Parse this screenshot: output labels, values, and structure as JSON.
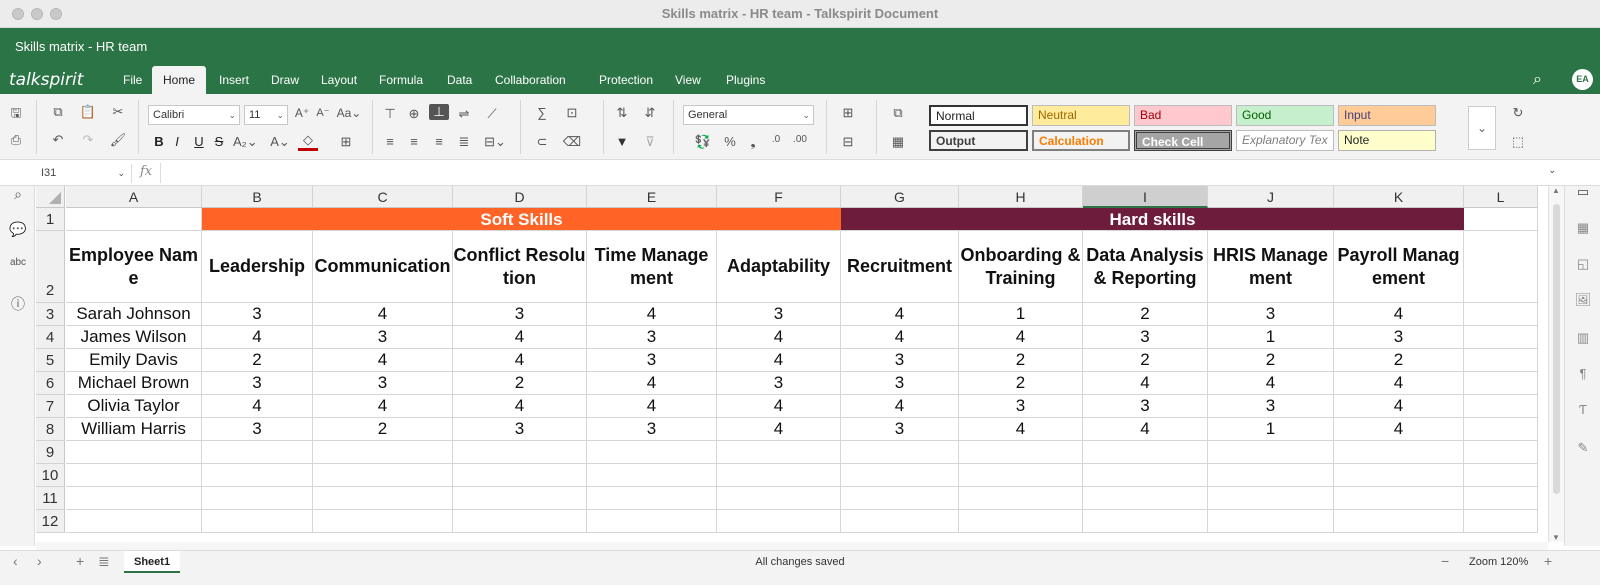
{
  "window": {
    "title": "Skills matrix - HR team - Talkspirit Document"
  },
  "doc": {
    "title": "Skills matrix - HR team"
  },
  "app": {
    "logo": "talkspirit",
    "avatar": "EA"
  },
  "menu": [
    "File",
    "Home",
    "Insert",
    "Draw",
    "Layout",
    "Formula",
    "Data",
    "Collaboration",
    "Protection",
    "View",
    "Plugins"
  ],
  "toolbar": {
    "font_name": "Calibri",
    "font_size": "11",
    "number_format": "General",
    "bold": "B",
    "italic": "I",
    "underline": "U",
    "strike": "S",
    "percent": "%",
    "styles": [
      "Normal",
      "Neutral",
      "Bad",
      "Good",
      "Input",
      "Output",
      "Calculation",
      "Check Cell",
      "Explanatory Tex",
      "Note"
    ]
  },
  "formula_bar": {
    "cell_ref": "I31",
    "fx": "fx",
    "value": ""
  },
  "grid": {
    "columns": [
      "A",
      "B",
      "C",
      "D",
      "E",
      "F",
      "G",
      "H",
      "I",
      "J",
      "K",
      "L"
    ],
    "selected_column": "I",
    "rows": [
      "1",
      "2",
      "3",
      "4",
      "5",
      "6",
      "7",
      "8",
      "9",
      "10",
      "11",
      "12"
    ],
    "groups": [
      {
        "label": "Soft Skills",
        "color": "#ff6325"
      },
      {
        "label": "Hard skills",
        "color": "#6e1c3c"
      }
    ],
    "headers": [
      "Employee Name",
      "Leadership",
      "Communication",
      "Conflict Resolution",
      "Time Management",
      "Adaptability",
      "Recruitment",
      "Onboarding & Training",
      "Data Analysis & Reporting",
      "HRIS Management",
      "Payroll Management"
    ],
    "employees": [
      {
        "name": "Sarah Johnson",
        "scores": [
          "3",
          "4",
          "3",
          "4",
          "3",
          "4",
          "1",
          "2",
          "3",
          "4"
        ]
      },
      {
        "name": "James Wilson",
        "scores": [
          "4",
          "3",
          "4",
          "3",
          "4",
          "4",
          "4",
          "3",
          "1",
          "3"
        ]
      },
      {
        "name": "Emily Davis",
        "scores": [
          "2",
          "4",
          "4",
          "3",
          "4",
          "3",
          "2",
          "2",
          "2",
          "2"
        ]
      },
      {
        "name": "Michael Brown",
        "scores": [
          "3",
          "3",
          "2",
          "4",
          "3",
          "3",
          "2",
          "4",
          "4",
          "4"
        ]
      },
      {
        "name": "Olivia Taylor",
        "scores": [
          "4",
          "4",
          "4",
          "4",
          "4",
          "4",
          "3",
          "3",
          "3",
          "4"
        ]
      },
      {
        "name": "William Harris",
        "scores": [
          "3",
          "2",
          "3",
          "3",
          "4",
          "3",
          "4",
          "4",
          "1",
          "4"
        ]
      }
    ]
  },
  "bottom": {
    "sheet": "Sheet1",
    "status": "All changes saved",
    "zoom": "Zoom 120%"
  }
}
